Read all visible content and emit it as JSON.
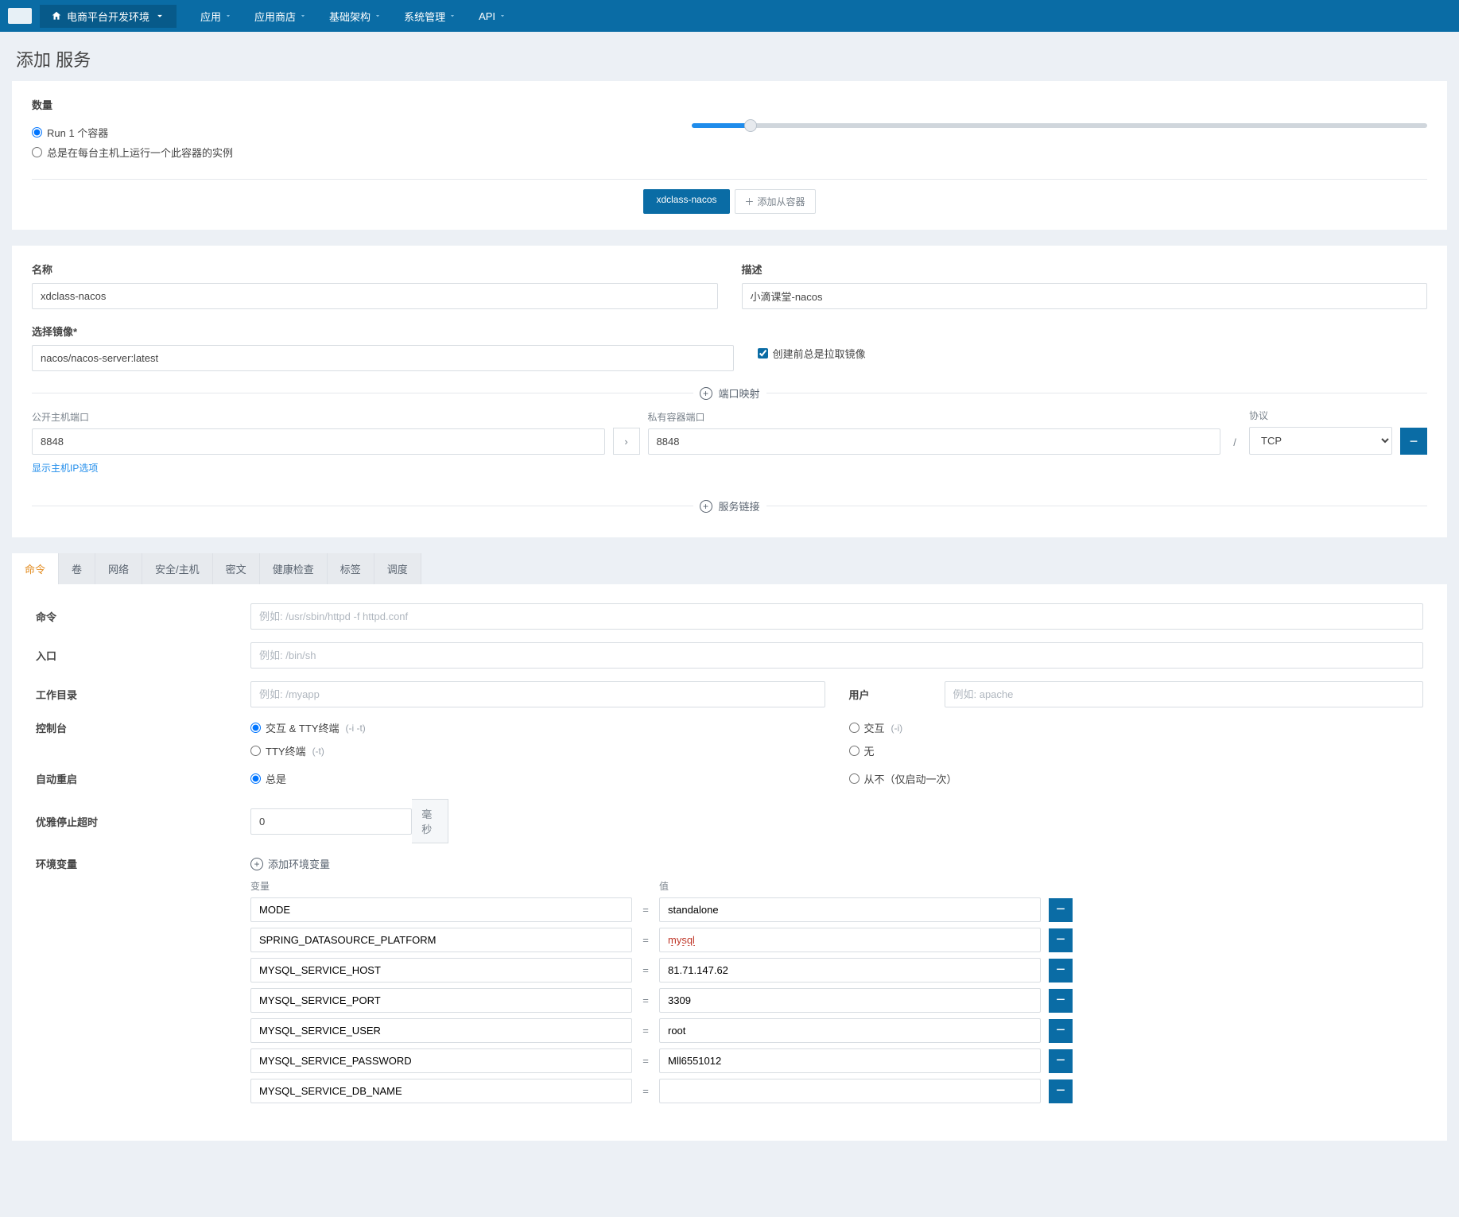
{
  "nav": {
    "env": "电商平台开发环境",
    "menus": [
      "应用",
      "应用商店",
      "基础架构",
      "系统管理",
      "API"
    ]
  },
  "page_title": "添加 服务",
  "qty": {
    "label": "数量",
    "opt_run": "Run 1 个容器",
    "opt_every_host": "总是在每台主机上运行一个此容器的实例"
  },
  "container_tabs": {
    "active": "xdclass-nacos",
    "add": "添加从容器"
  },
  "form": {
    "name_label": "名称",
    "name_value": "xdclass-nacos",
    "desc_label": "描述",
    "desc_value": "小滴课堂-nacos",
    "image_label": "选择镜像*",
    "image_value": "nacos/nacos-server:latest",
    "pull_label": "创建前总是拉取镜像",
    "port_section": "端口映射",
    "public_port_label": "公开主机端口",
    "public_port_value": "8848",
    "private_port_label": "私有容器端口",
    "private_port_value": "8848",
    "protocol_label": "协议",
    "protocol_value": "TCP",
    "show_ip_link": "显示主机IP选项",
    "link_section": "服务链接"
  },
  "tabs": [
    "命令",
    "卷",
    "网络",
    "安全/主机",
    "密文",
    "健康检查",
    "标签",
    "调度"
  ],
  "cmd": {
    "cmd_label": "命令",
    "cmd_ph": "例如: /usr/sbin/httpd -f httpd.conf",
    "entry_label": "入口",
    "entry_ph": "例如: /bin/sh",
    "workdir_label": "工作目录",
    "workdir_ph": "例如: /myapp",
    "user_label": "用户",
    "user_ph": "例如: apache",
    "console_label": "控制台",
    "console_opt1": "交互 & TTY终端",
    "console_opt1_hint": "(-i -t)",
    "console_opt2": "TTY终端",
    "console_opt2_hint": "(-t)",
    "console_opt3": "交互",
    "console_opt3_hint": "(-i)",
    "console_opt4": "无",
    "restart_label": "自动重启",
    "restart_opt1": "总是",
    "restart_opt2": "从不（仅启动一次）",
    "timeout_label": "优雅停止超时",
    "timeout_value": "0",
    "timeout_unit": "毫秒",
    "env_label": "环境变量",
    "env_add": "添加环境变量",
    "env_var_head": "变量",
    "env_val_head": "值",
    "envs": [
      {
        "k": "MODE",
        "v": "standalone"
      },
      {
        "k": "SPRING_DATASOURCE_PLATFORM",
        "v": "mysql",
        "flag": true
      },
      {
        "k": "MYSQL_SERVICE_HOST",
        "v": "81.71.147.62"
      },
      {
        "k": "MYSQL_SERVICE_PORT",
        "v": "3309"
      },
      {
        "k": "MYSQL_SERVICE_USER",
        "v": "root"
      },
      {
        "k": "MYSQL_SERVICE_PASSWORD",
        "v": "Mll6551012"
      },
      {
        "k": "MYSQL_SERVICE_DB_NAME",
        "v": ""
      }
    ]
  }
}
